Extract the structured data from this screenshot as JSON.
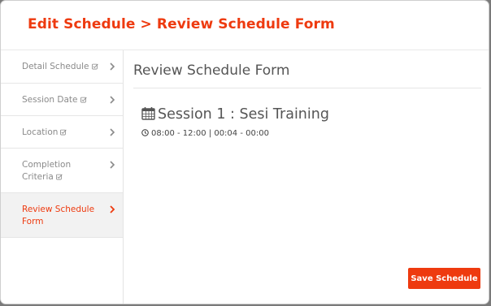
{
  "modal": {
    "title": "Edit Schedule > Review Schedule Form"
  },
  "sidebar": {
    "items": [
      {
        "label": "Detail Schedule",
        "check_icon": "check-square-icon",
        "arrow_icon": "chevron-right-icon",
        "active": false
      },
      {
        "label": "Session Date",
        "check_icon": "check-square-icon",
        "arrow_icon": "chevron-right-icon",
        "active": false
      },
      {
        "label": "Location",
        "check_icon": "check-square-icon",
        "arrow_icon": "chevron-right-icon",
        "active": false
      },
      {
        "label": "Completion Criteria",
        "check_icon": "check-square-icon",
        "arrow_icon": "chevron-right-icon",
        "active": false
      },
      {
        "label": "Review Schedule Form",
        "arrow_icon": "chevron-right-icon",
        "active": true
      }
    ]
  },
  "content": {
    "title": "Review Schedule Form",
    "session": {
      "icon": "calendar-icon",
      "title": "Session 1 : Sesi Training",
      "time_icon": "clock-icon",
      "time": "08:00 - 12:00 | 00:04 - 00:00"
    },
    "save_label": "Save Schedule"
  },
  "colors": {
    "accent": "#ee3a0f",
    "active_bg": "#f2f2f2",
    "muted_text": "#8a8a8a",
    "backdrop": "#7a7a7a"
  }
}
